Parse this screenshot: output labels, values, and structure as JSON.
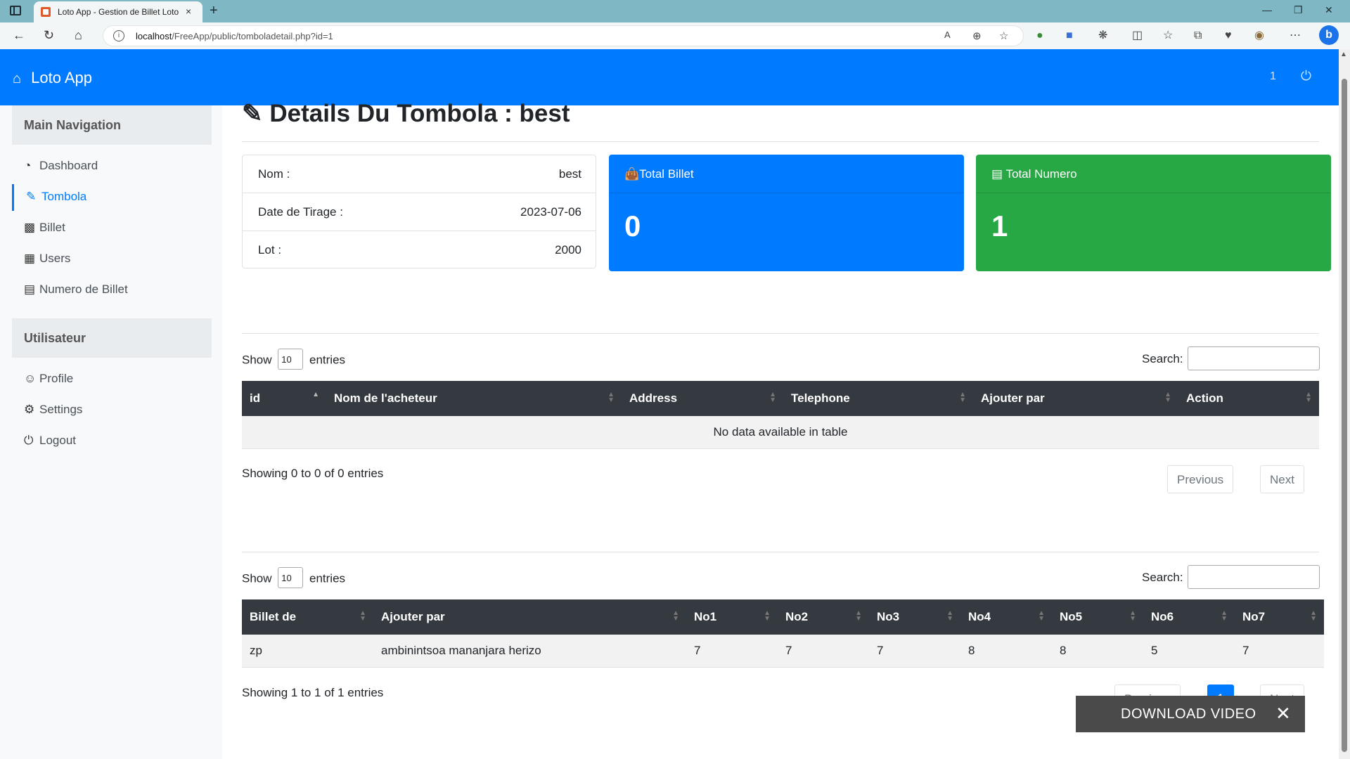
{
  "browser": {
    "tab_title": "Loto App - Gestion de Billet Loto",
    "tab_close": "×",
    "new_tab": "+",
    "url_host": "localhost",
    "url_path": "/FreeApp/public/tomboladetail.php?id=1",
    "read_aloud": "A",
    "window_controls": [
      "—",
      "❐",
      "✕"
    ],
    "bing_label": "b"
  },
  "header": {
    "brand": "Loto App",
    "brand_icon": "home-icon",
    "count": "1",
    "power_icon": "power-icon"
  },
  "sidebar": {
    "main_heading": "Main Navigation",
    "main_items": [
      {
        "label": "Dashboard",
        "icon": "dashboard-icon"
      },
      {
        "label": "Tombola",
        "icon": "edit-icon"
      },
      {
        "label": "Billet",
        "icon": "monitor-icon"
      },
      {
        "label": "Users",
        "icon": "table-icon"
      },
      {
        "label": "Numero de Billet",
        "icon": "bar-chart-icon"
      }
    ],
    "user_heading": "Utilisateur",
    "user_items": [
      {
        "label": "Profile",
        "icon": "user-icon"
      },
      {
        "label": "Settings",
        "icon": "gear-icon"
      },
      {
        "label": "Logout",
        "icon": "power-icon"
      }
    ]
  },
  "page": {
    "title": "Details Du Tombola : best",
    "info": [
      {
        "label": "Nom :",
        "value": "best"
      },
      {
        "label": "Date de Tirage :",
        "value": "2023-07-06"
      },
      {
        "label": "Lot :",
        "value": "2000"
      }
    ],
    "stats": [
      {
        "label": "Total Billet",
        "value": "0",
        "color": "#007bff",
        "icon": "shopping-bag-icon"
      },
      {
        "label": "Total Numero",
        "value": "1",
        "color": "#28a745",
        "icon": "bar-chart-icon"
      }
    ]
  },
  "table1": {
    "show": "Show",
    "length": "10",
    "entries": "entries",
    "search_label": "Search:",
    "columns": [
      "id",
      "Nom de l'acheteur",
      "Address",
      "Telephone",
      "Ajouter par",
      "Action"
    ],
    "empty_text": "No data available in table",
    "info": "Showing 0 to 0 of 0 entries",
    "prev": "Previous",
    "next": "Next"
  },
  "table2": {
    "show": "Show",
    "length": "10",
    "entries": "entries",
    "search_label": "Search:",
    "columns": [
      "Billet de",
      "Ajouter par",
      "No1",
      "No2",
      "No3",
      "No4",
      "No5",
      "No6",
      "No7"
    ],
    "rows": [
      [
        "zp",
        "ambinintsoa mananjara herizo",
        "7",
        "7",
        "7",
        "8",
        "8",
        "5",
        "7"
      ]
    ],
    "info": "Showing 1 to 1 of 1 entries",
    "prev": "Previous",
    "page": "1",
    "next": "Next"
  },
  "overlay": {
    "label": "DOWNLOAD VIDEO",
    "close": "✕"
  }
}
